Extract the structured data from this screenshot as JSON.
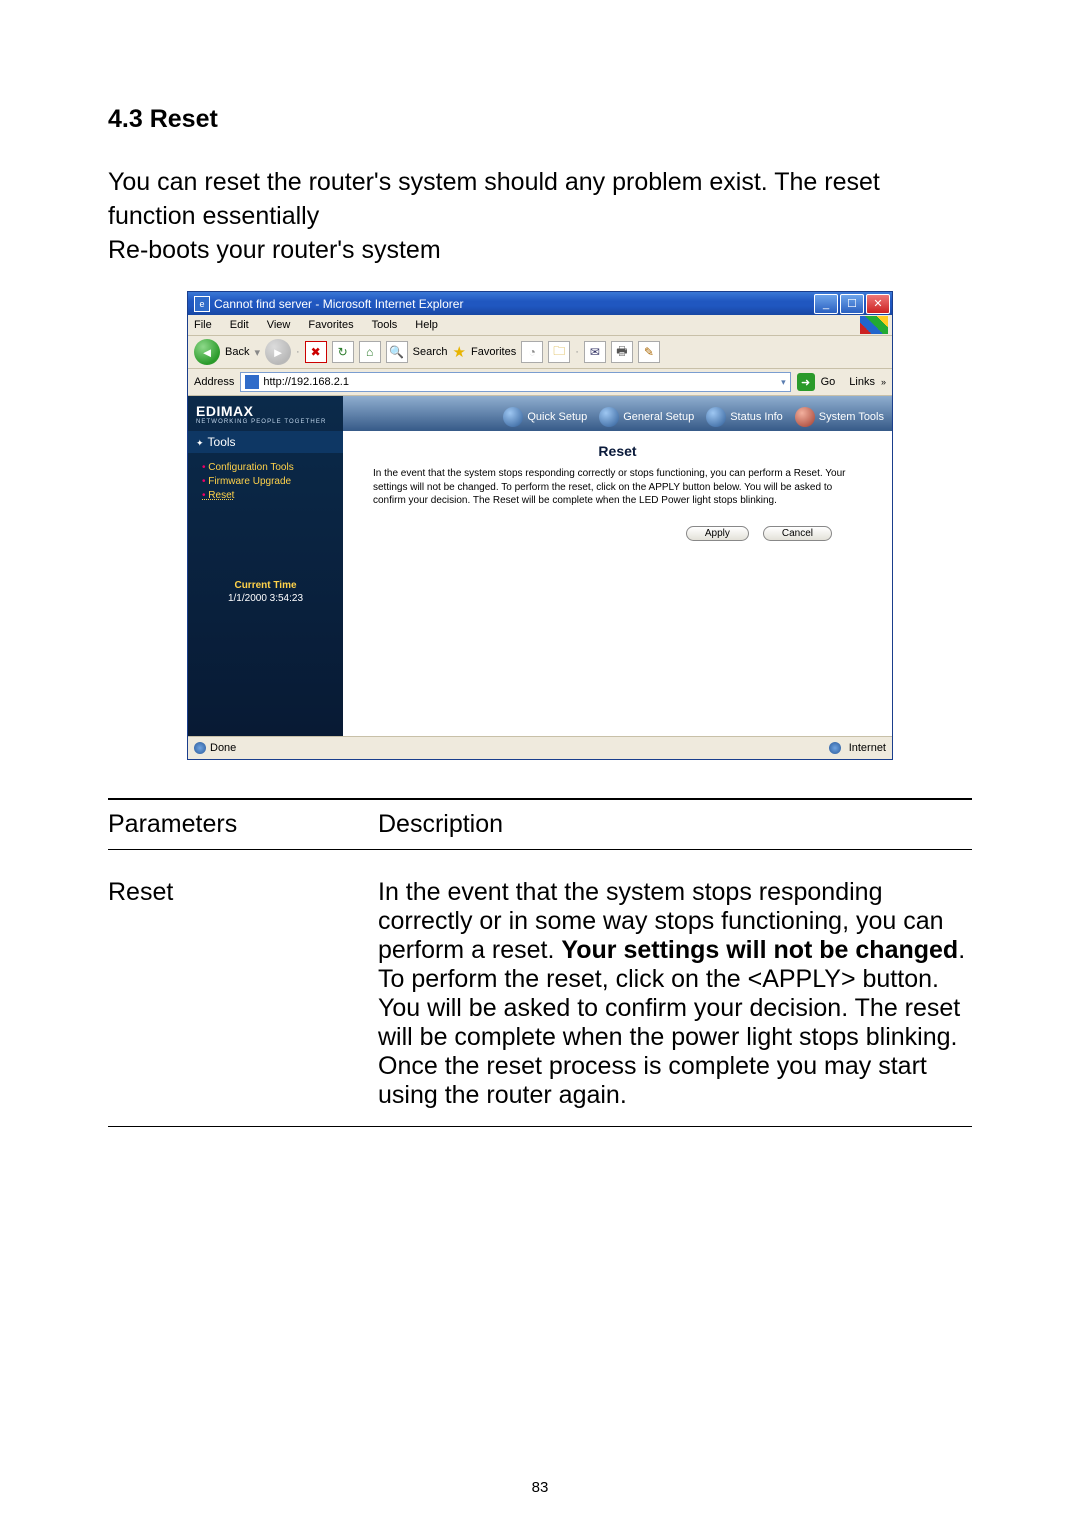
{
  "section": {
    "number": "4.3",
    "title": "Reset"
  },
  "intro": {
    "line1": "You can reset the router's system should any problem exist. The reset function essentially",
    "line2": "Re-boots your router's system"
  },
  "ie": {
    "title": "Cannot find server - Microsoft Internet Explorer",
    "menus": [
      "File",
      "Edit",
      "View",
      "Favorites",
      "Tools",
      "Help"
    ],
    "back": "Back",
    "search": "Search",
    "favorites": "Favorites",
    "addrLabel": "Address",
    "addrValue": "http://192.168.2.1",
    "go": "Go",
    "links": "Links",
    "statusDone": "Done",
    "statusZone": "Internet"
  },
  "router": {
    "brand": "EDIMAX",
    "tagline": "NETWORKING PEOPLE TOGETHER",
    "tabs": {
      "quick": "Quick Setup",
      "general": "General Setup",
      "status": "Status Info",
      "tools": "System Tools"
    },
    "sidebar": {
      "header": "Tools",
      "items": [
        {
          "label": "Configuration Tools"
        },
        {
          "label": "Firmware Upgrade"
        },
        {
          "label": "Reset",
          "underline": true
        }
      ],
      "timeLabel": "Current Time",
      "timeValue": "1/1/2000 3:54:23"
    },
    "page": {
      "title": "Reset",
      "body": "In the event that the system stops responding correctly or stops functioning, you can perform a Reset. Your settings will not be changed. To perform the reset, click on the APPLY button below. You will be asked to confirm your decision. The Reset will be complete when the LED Power light stops blinking.",
      "apply": "Apply",
      "cancel": "Cancel"
    }
  },
  "table": {
    "h1": "Parameters",
    "h2": "Description",
    "row": {
      "param": "Reset",
      "desc_pre": "In the event that the system stops responding correctly or in some way stops functioning, you can perform a reset. ",
      "desc_bold": "Your settings will not be changed",
      "desc_post": ". To perform the reset, click on the <APPLY> button. You will be asked to confirm your decision. The reset will be complete when the power light stops blinking. Once the reset process is complete you may start using the router again."
    }
  },
  "pageNumber": "83"
}
